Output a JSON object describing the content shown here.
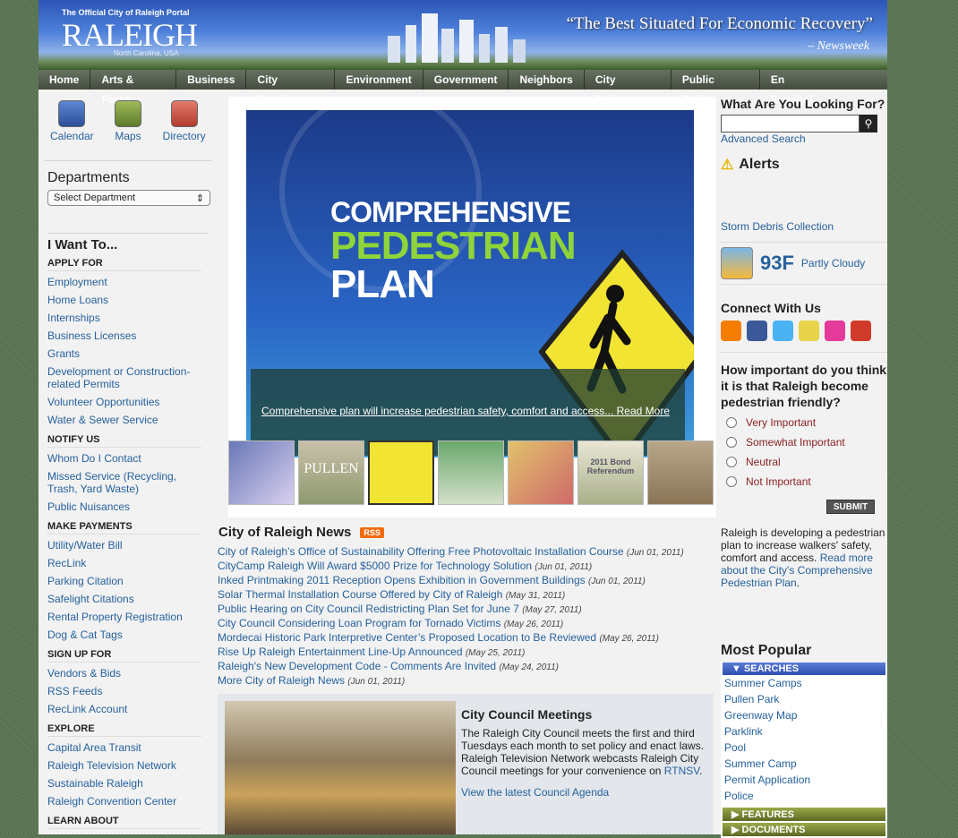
{
  "header": {
    "tagline": "The Official City of Raleigh Portal",
    "logo": "RALEIGH",
    "logo_sub": "North Carolina, USA",
    "quote": "“The Best Situated For Economic Recovery”",
    "quote_source": "– Newsweek"
  },
  "nav": {
    "items": [
      "Home",
      "Arts & Parks",
      "Business",
      "City Services",
      "Environment",
      "Government",
      "Neighbors",
      "City Projects",
      "Public Safety"
    ],
    "espanol": "En Español"
  },
  "quick": [
    {
      "label": "Calendar",
      "icon": "calendar-icon"
    },
    {
      "label": "Maps",
      "icon": "globe-icon"
    },
    {
      "label": "Directory",
      "icon": "envelope-icon"
    }
  ],
  "departments": {
    "heading": "Departments",
    "select": "Select Department"
  },
  "iwant": {
    "heading": "I Want To...",
    "sections": [
      {
        "title": "APPLY FOR",
        "links": [
          "Employment",
          "Home Loans",
          "Internships",
          "Business Licenses",
          "Grants",
          "Development or Construction-related Permits",
          "Volunteer Opportunities",
          "Water & Sewer Service"
        ]
      },
      {
        "title": "NOTIFY US",
        "links": [
          "Whom Do I Contact",
          "Missed Service (Recycling, Trash, Yard Waste)",
          "Public Nuisances"
        ]
      },
      {
        "title": "MAKE PAYMENTS",
        "links": [
          "Utility/Water Bill",
          "RecLink",
          "Parking Citation",
          "Safelight Citations",
          "Rental Property Registration",
          "Dog & Cat Tags"
        ]
      },
      {
        "title": "SIGN UP FOR",
        "links": [
          "Vendors & Bids",
          "RSS Feeds",
          "RecLink Account"
        ]
      },
      {
        "title": "EXPLORE",
        "links": [
          "Capital Area Transit",
          "Raleigh Television Network",
          "Sustainable Raleigh",
          "Raleigh Convention Center"
        ]
      },
      {
        "title": "LEARN ABOUT",
        "links": []
      }
    ]
  },
  "slide": {
    "t1": "COMPREHENSIVE",
    "t2": "PEDESTRIAN",
    "t3": "PLAN",
    "caption": "Comprehensive plan will increase pedestrian safety, comfort and access... Read More",
    "thumbs": [
      "",
      "PULLEN",
      "",
      "",
      "",
      "2011 Bond Referendum",
      ""
    ]
  },
  "news": {
    "heading": "City of Raleigh News",
    "rss": "RSS",
    "items": [
      {
        "title": "City of Raleigh’s Office of Sustainability Offering Free Photovoltaic Installation Course",
        "date": "(Jun 01, 2011)"
      },
      {
        "title": "CityCamp Raleigh Will Award $5000 Prize for Technology Solution",
        "date": "(Jun 01, 2011)"
      },
      {
        "title": "Inked Printmaking 2011 Reception Opens Exhibition in Government Buildings",
        "date": "(Jun 01, 2011)"
      },
      {
        "title": "Solar Thermal Installation Course Offered by City of Raleigh",
        "date": "(May 31, 2011)"
      },
      {
        "title": "Public Hearing on City Council Redistricting Plan Set for June 7",
        "date": "(May 27, 2011)"
      },
      {
        "title": "City Council Considering Loan Program for Tornado Victims",
        "date": "(May 26, 2011)"
      },
      {
        "title": "Mordecai Historic Park Interpretive Center’s Proposed Location to Be Reviewed",
        "date": "(May 26, 2011)"
      },
      {
        "title": "Rise Up Raleigh Entertainment Line-Up Announced",
        "date": "(May 25, 2011)"
      },
      {
        "title": "Raleigh's New Development Code - Comments Are Invited",
        "date": "(May 24, 2011)"
      },
      {
        "title": "More City of Raleigh News",
        "date": "(Jun 01, 2011)"
      }
    ]
  },
  "council": {
    "heading": "City Council Meetings",
    "text": "The Raleigh City Council meets the first and third Tuesdays each month to set policy and enact laws. Raleigh Television Network webcasts Raleigh City Council meetings for your convenience on ",
    "rtnsv": "RTNSV",
    "text_end": ".",
    "agenda": "View the latest Council Agenda"
  },
  "search": {
    "heading": "What Are You Looking For?",
    "advanced": "Advanced Search"
  },
  "alerts": {
    "heading": "Alerts",
    "item": "Storm Debris Collection"
  },
  "weather": {
    "temp": "93F",
    "cond": "Partly Cloudy"
  },
  "connect": {
    "heading": "Connect With Us",
    "icons": [
      {
        "name": "blogger-icon",
        "color": "#f57d00"
      },
      {
        "name": "facebook-icon",
        "color": "#3b5998"
      },
      {
        "name": "twitter-icon",
        "color": "#4ab3f4"
      },
      {
        "name": "flickr-icon",
        "color": "#e8d44a"
      },
      {
        "name": "flickr-icon-2",
        "color": "#e43a9b"
      },
      {
        "name": "youtube-icon",
        "color": "#d03a2a"
      }
    ]
  },
  "poll": {
    "question": "How important do you think it is that Raleigh become pedestrian friendly?",
    "options": [
      "Very Important",
      "Somewhat Important",
      "Neutral",
      "Not Important"
    ],
    "submit": "SUBMIT",
    "text": "Raleigh is developing a pedestrian plan to increase walkers' safety, comfort and access. ",
    "link": "Read more about the City's Comprehensive Pedestrian Plan",
    "link_end": "."
  },
  "popular": {
    "heading": "Most Popular",
    "searches_label": "▼ SEARCHES",
    "searches": [
      "Summer Camps",
      "Pullen Park",
      "Greenway Map",
      "Parklink",
      "Pool",
      "Summer Camp",
      "Permit Application",
      "Police"
    ],
    "features": "▶ FEATURES",
    "documents": "▶ DOCUMENTS"
  }
}
